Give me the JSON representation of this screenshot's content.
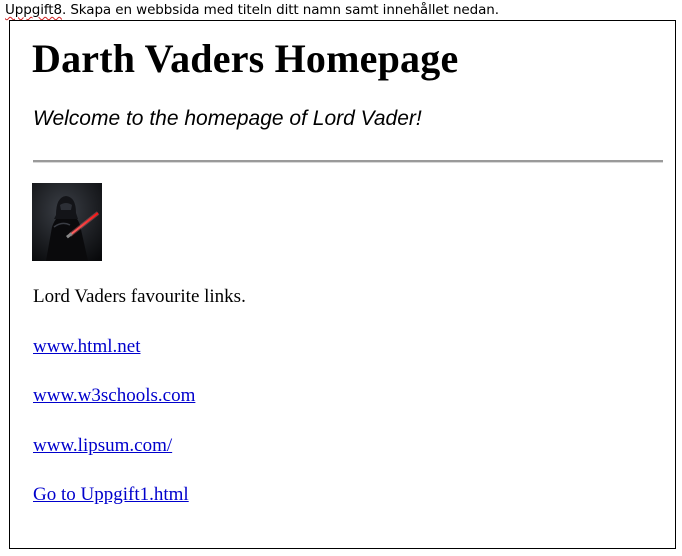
{
  "assignment": {
    "prefix": "Uppgift8",
    "text": ". Skapa en webbsida med titeln ditt namn samt innehållet nedan."
  },
  "page": {
    "title": "Darth Vaders Homepage",
    "welcome": "Welcome to the homepage of Lord Vader!",
    "links_intro": "Lord Vaders favourite links.",
    "links": [
      {
        "label": "www.html.net"
      },
      {
        "label": "www.w3schools.com"
      },
      {
        "label": "www.lipsum.com/"
      },
      {
        "label": "Go to Uppgift1.html"
      }
    ]
  },
  "colors": {
    "link": "#0000cc",
    "rule": "#9a9a9a",
    "lightsaber": "#ff2a2a"
  },
  "image": {
    "depicts": "darth-vader-with-lightsaber"
  }
}
